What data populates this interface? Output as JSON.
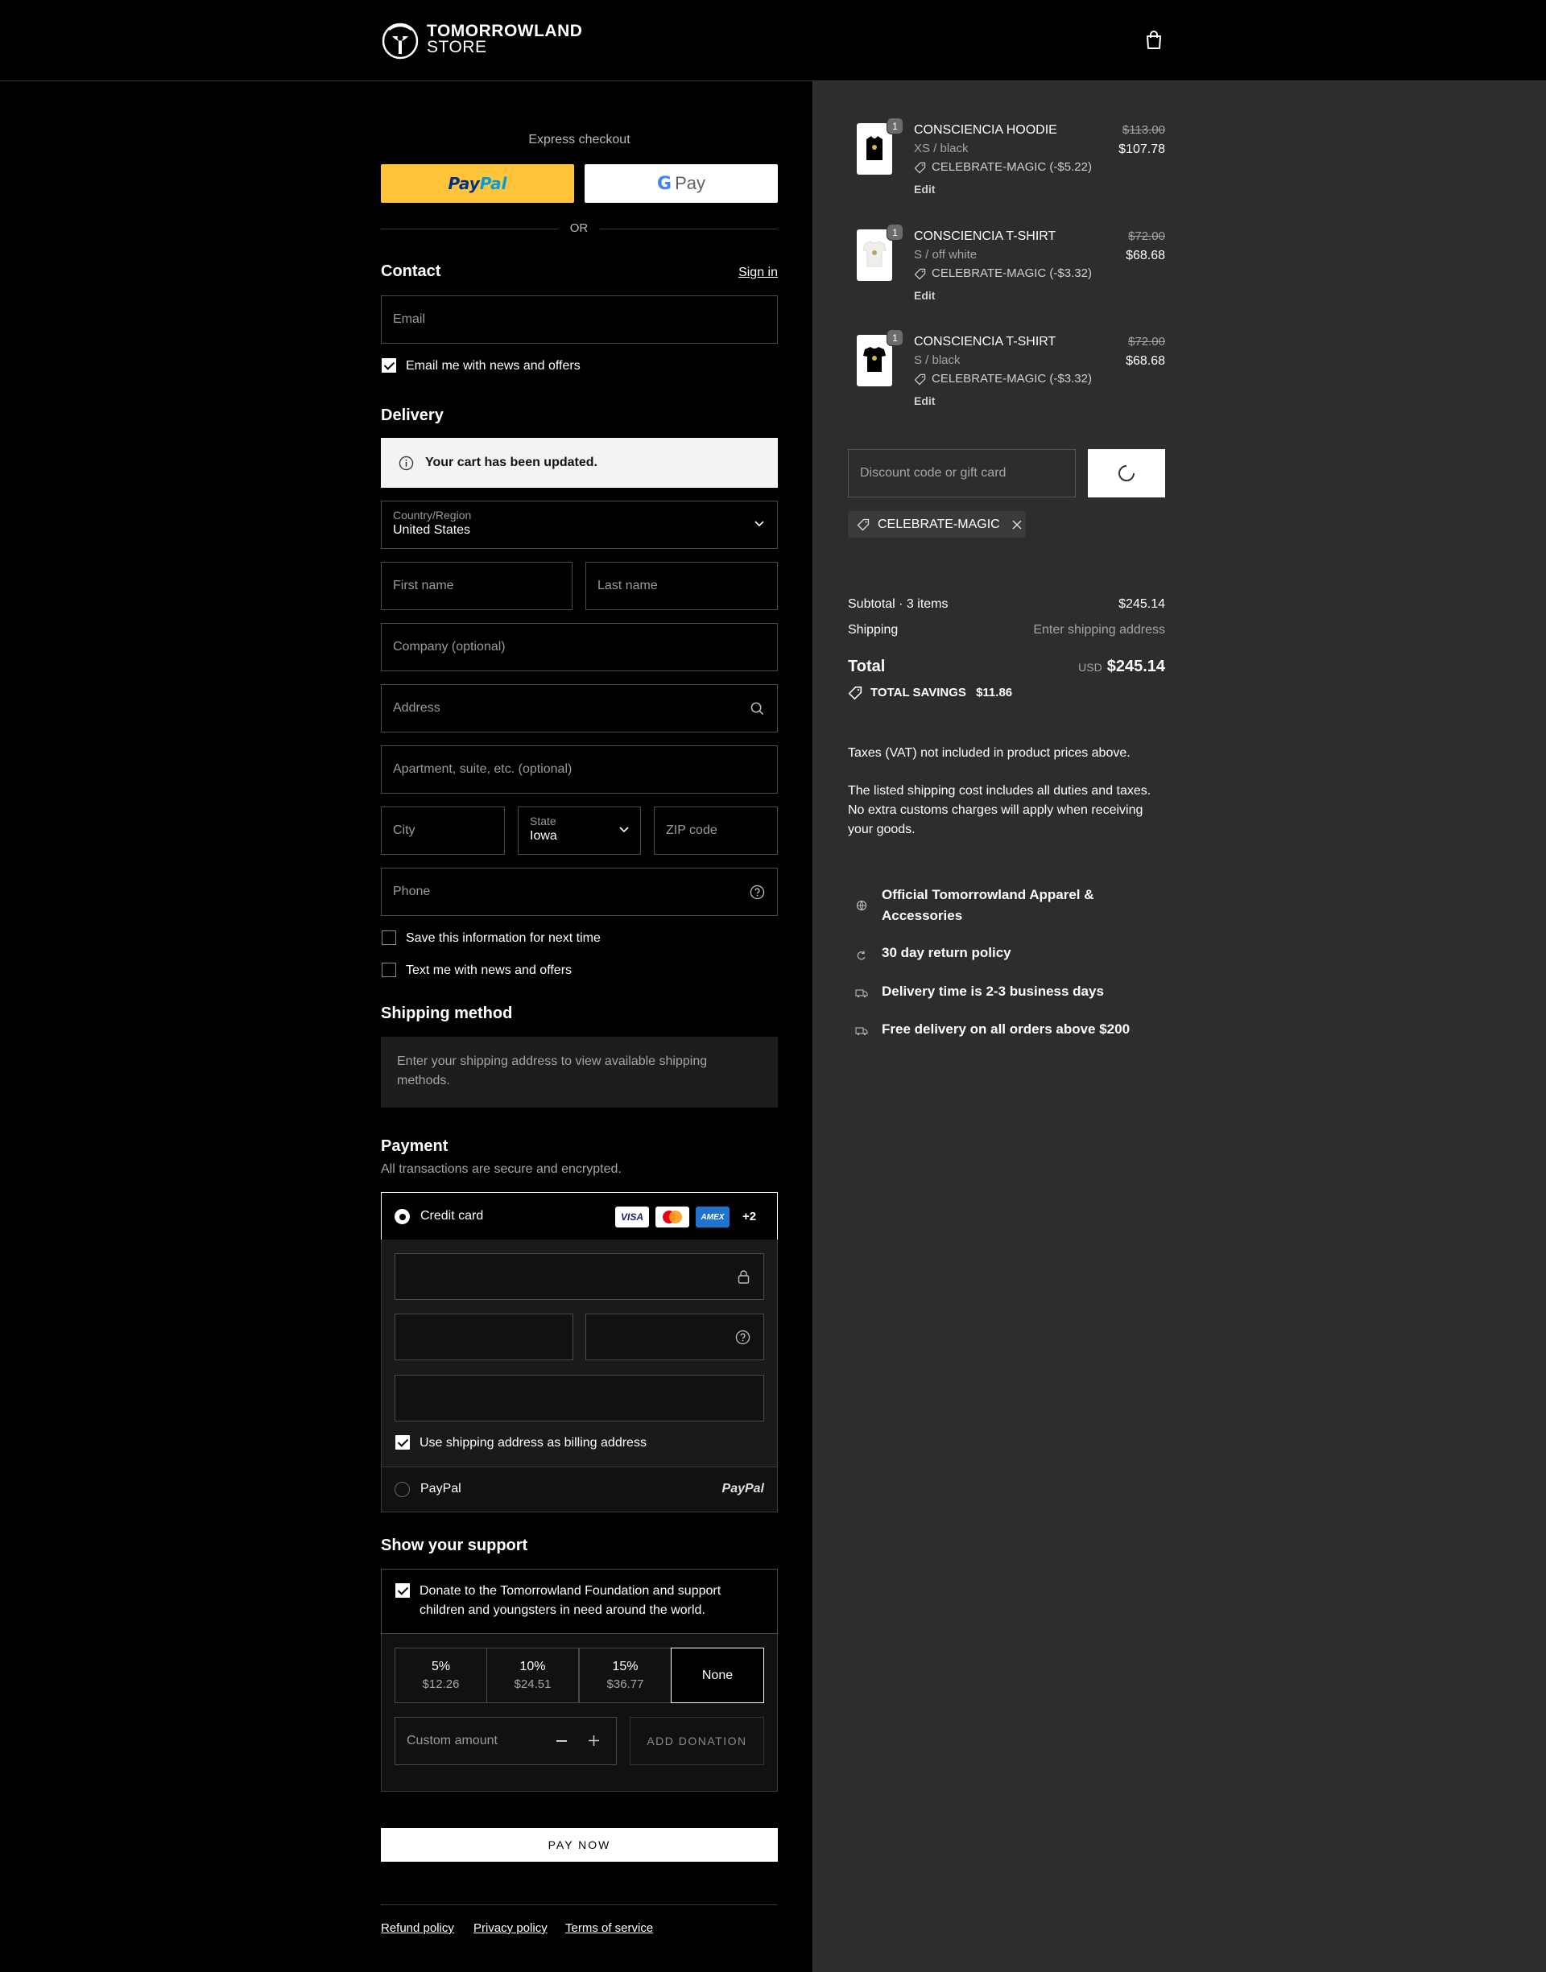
{
  "header": {
    "logo_line1": "TOMORROWLAND",
    "logo_line2": "STORE"
  },
  "express": {
    "title": "Express checkout",
    "paypal_label": "PayPal",
    "gpay_label": "Pay",
    "or_label": "OR"
  },
  "contact": {
    "title": "Contact",
    "sign_in": "Sign in",
    "email_placeholder": "Email",
    "news_label": "Email me with news and offers",
    "news_checked": true
  },
  "delivery": {
    "title": "Delivery",
    "notice": "Your cart has been updated.",
    "country_label": "Country/Region",
    "country_value": "United States",
    "first_name": "First name",
    "last_name": "Last name",
    "company": "Company (optional)",
    "address": "Address",
    "apartment": "Apartment, suite, etc. (optional)",
    "city": "City",
    "state_label": "State",
    "state_value": "Iowa",
    "zip": "ZIP code",
    "phone": "Phone",
    "save_info": "Save this information for next time",
    "text_me": "Text me with news and offers"
  },
  "shipping": {
    "title": "Shipping method",
    "message": "Enter your shipping address to view available shipping methods."
  },
  "payment": {
    "title": "Payment",
    "subtitle": "All transactions are secure and encrypted.",
    "credit_card": "Credit card",
    "card_brands": [
      "VISA",
      "Mastercard",
      "AMEX"
    ],
    "more_brands": "+2",
    "billing_label": "Use shipping address as billing address",
    "paypal_option": "PayPal",
    "paypal_logo": "PayPal"
  },
  "support": {
    "title": "Show your support",
    "donate_text": "Donate to the Tomorrowland Foundation and support children and youngsters in need around the world.",
    "options": [
      {
        "pct": "5%",
        "amount": "$12.26"
      },
      {
        "pct": "10%",
        "amount": "$24.51"
      },
      {
        "pct": "15%",
        "amount": "$36.77"
      }
    ],
    "none_label": "None",
    "custom_placeholder": "Custom amount",
    "add_donation": "ADD DONATION"
  },
  "pay_now": "PAY NOW",
  "footer": {
    "links": [
      "Refund policy",
      "Privacy policy",
      "Terms of service"
    ]
  },
  "cart": {
    "items": [
      {
        "qty": "1",
        "name": "CONSCIENCIA HOODIE",
        "variant": "XS / black",
        "discount": "CELEBRATE-MAGIC (-$5.22)",
        "edit": "Edit",
        "old_price": "$113.00",
        "price": "$107.78",
        "thumb": "black"
      },
      {
        "qty": "1",
        "name": "CONSCIENCIA T-SHIRT",
        "variant": "S / off white",
        "discount": "CELEBRATE-MAGIC (-$3.32)",
        "edit": "Edit",
        "old_price": "$72.00",
        "price": "$68.68",
        "thumb": "white"
      },
      {
        "qty": "1",
        "name": "CONSCIENCIA T-SHIRT",
        "variant": "S / black",
        "discount": "CELEBRATE-MAGIC (-$3.32)",
        "edit": "Edit",
        "old_price": "$72.00",
        "price": "$68.68",
        "thumb": "black"
      }
    ],
    "discount_placeholder": "Discount code or gift card",
    "applied_code": "CELEBRATE-MAGIC",
    "subtotal_label": "Subtotal · 3 items",
    "subtotal_value": "$245.14",
    "shipping_label": "Shipping",
    "shipping_value": "Enter shipping address",
    "total_label": "Total",
    "currency": "USD",
    "total_value": "$245.14",
    "savings_label": "TOTAL SAVINGS",
    "savings_value": "$11.86",
    "tax_note": "Taxes (VAT) not included in product prices above.",
    "duties_note": "The listed shipping cost includes all duties and taxes. No extra customs charges will apply when receiving your goods.",
    "perks": [
      {
        "icon": "globe-icon",
        "text": "Official Tomorrowland Apparel & Accessories"
      },
      {
        "icon": "return-icon",
        "text": "30 day return policy"
      },
      {
        "icon": "truck-icon",
        "text": "Delivery time is 2-3 business days"
      },
      {
        "icon": "truck-icon",
        "text": "Free delivery on all orders above $200"
      }
    ]
  },
  "colors": {
    "paypal_yellow": "#ffc439",
    "paypal_blue": "#003087",
    "paypal_lightblue": "#009cde",
    "right_panel_bg": "#2d2d2d"
  }
}
